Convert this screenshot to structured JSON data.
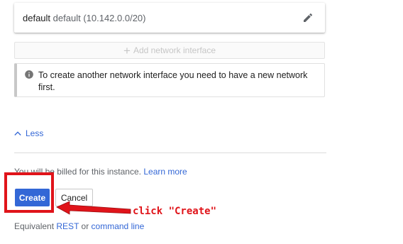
{
  "network_interface": {
    "name": "default",
    "detail": "default (10.142.0.0/20)",
    "edit_icon": "pencil-icon"
  },
  "add_interface": {
    "icon": "plus-icon",
    "label": "Add network interface"
  },
  "info": {
    "icon": "info-icon",
    "text": "To create another network interface you need to have a new network first."
  },
  "less_link": {
    "icon": "chevron-up-icon",
    "label": "Less"
  },
  "billing": {
    "text": "You will be billed for this instance.",
    "link": "Learn more"
  },
  "buttons": {
    "create": "Create",
    "cancel": "Cancel"
  },
  "equivalent": {
    "prefix": "Equivalent",
    "rest": "REST",
    "or": "or",
    "command_line": "command line"
  },
  "annotation": {
    "label": "click \"Create\"",
    "color": "#e0141a"
  },
  "colors": {
    "accent": "#3367d6",
    "link": "#3367d6"
  }
}
